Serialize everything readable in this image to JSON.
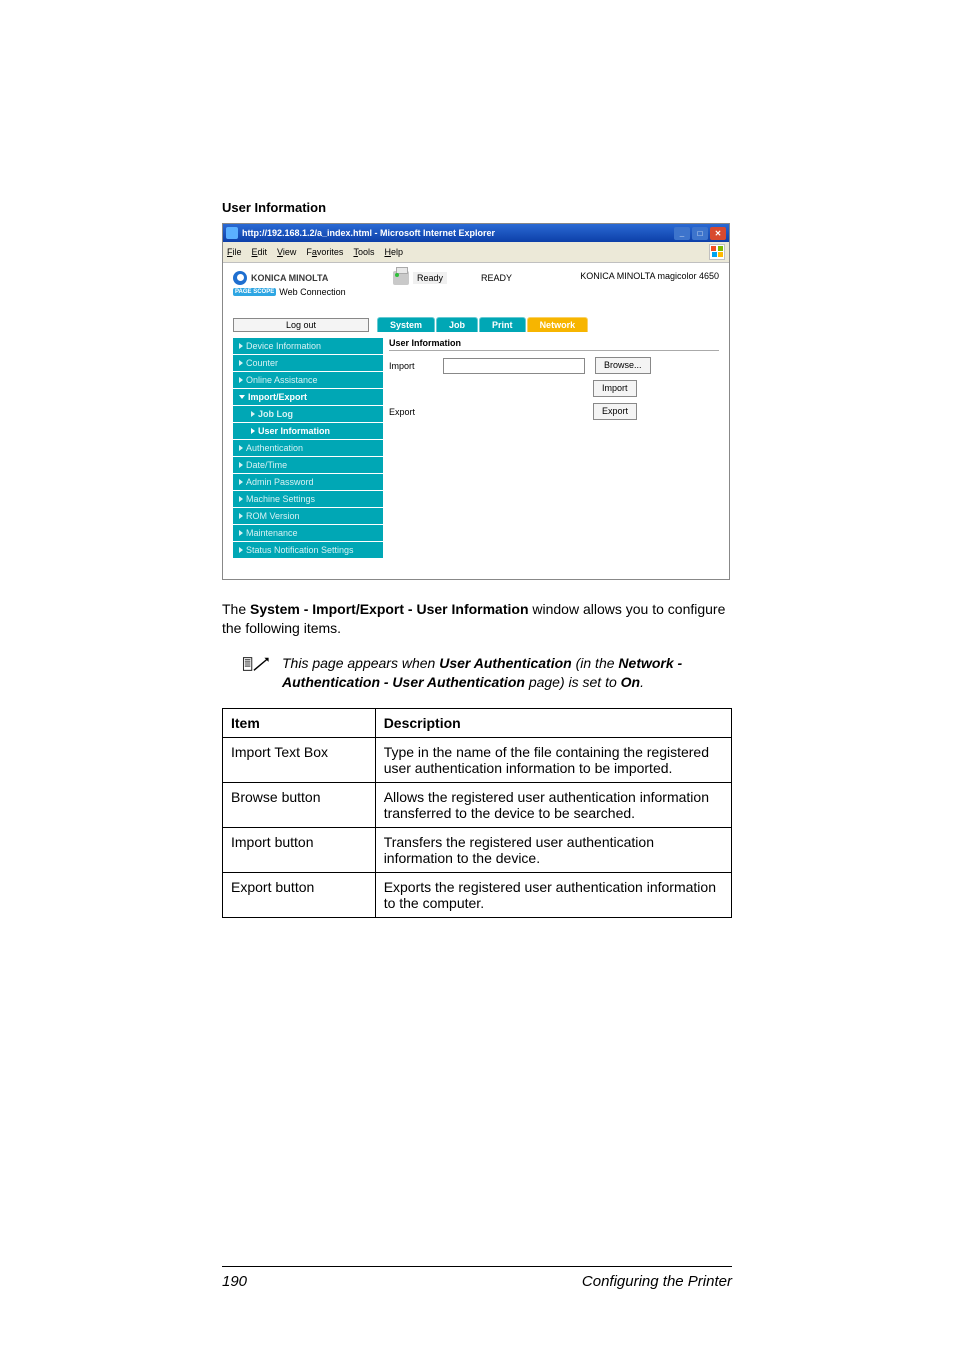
{
  "section_title": "User Information",
  "ie": {
    "titlebar": "http://192.168.1.2/a_index.html - Microsoft Internet Explorer",
    "menu": {
      "file": "File",
      "edit": "Edit",
      "view": "View",
      "favorites": "Favorites",
      "tools": "Tools",
      "help": "Help"
    }
  },
  "header": {
    "brand": "KONICA MINOLTA",
    "pagescope_badge": "PAGE SCOPE",
    "sub_brand": "Web Connection",
    "ready_small": "Ready",
    "ready_big": "READY",
    "model": "KONICA MINOLTA magicolor 4650"
  },
  "logout": "Log out",
  "tabs": {
    "system": "System",
    "job": "Job",
    "print": "Print",
    "network": "Network"
  },
  "sidebar": {
    "device_info": "Device Information",
    "counter": "Counter",
    "online": "Online Assistance",
    "import_export": "Import/Export",
    "job_log": "Job Log",
    "user_info": "User Information",
    "auth": "Authentication",
    "datetime": "Date/Time",
    "admin_pw": "Admin Password",
    "machine": "Machine Settings",
    "rom": "ROM Version",
    "maintenance": "Maintenance",
    "status_notif": "Status Notification Settings"
  },
  "detail": {
    "heading": "User Information",
    "import_label": "Import",
    "export_label": "Export",
    "browse": "Browse...",
    "import_btn": "Import",
    "export_btn": "Export"
  },
  "para": {
    "pre": "The ",
    "bold": "System - Import/Export - User Information",
    "post": " window allows you to configure the following items."
  },
  "note": {
    "l1a": "This page appears when ",
    "l1b": "User Authentication",
    "l1c": " (in the ",
    "l1d": "Network - Authentication - User Authentication",
    "l1e": " page) is set to ",
    "l1f": "On",
    "l1g": "."
  },
  "table": {
    "h1": "Item",
    "h2": "Description",
    "r1c1": "Import Text Box",
    "r1c2": "Type in the name of the file containing the registered user authentication information to be imported.",
    "r2c1": "Browse button",
    "r2c2": "Allows the registered user authentication information transferred to the device to be searched.",
    "r3c1": "Import button",
    "r3c2": "Transfers the registered user authentication information to the device.",
    "r4c1": "Export button",
    "r4c2": "Exports the registered user authentication information to the computer."
  },
  "footer": {
    "page": "190",
    "title": "Configuring the Printer"
  }
}
